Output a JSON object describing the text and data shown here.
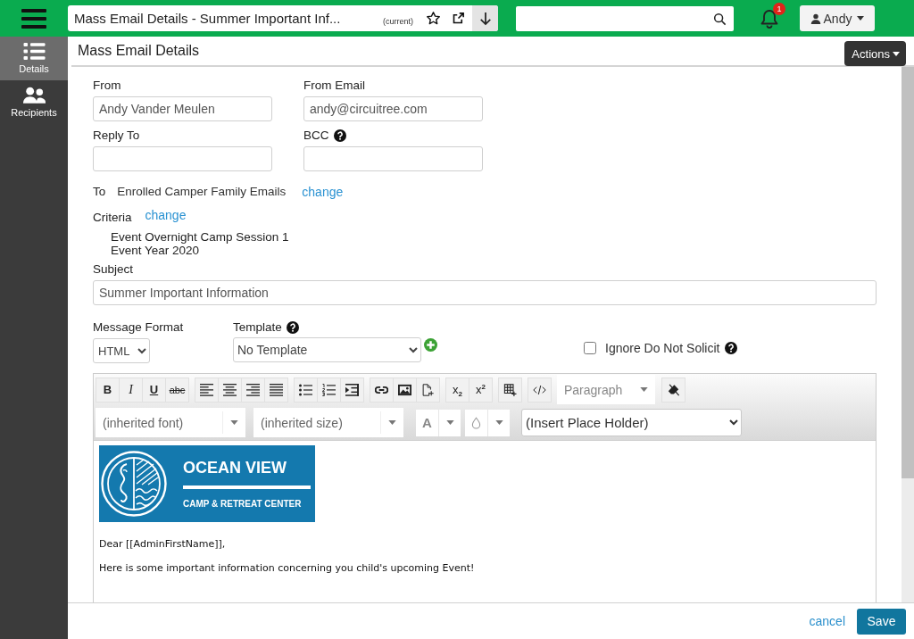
{
  "top_bar": {
    "page_title": "Mass Email Details - Summer Important Inf...",
    "page_tag": "(current)",
    "notification_count": "1",
    "user_name": "Andy"
  },
  "sidebar": {
    "items": [
      {
        "label": "Details",
        "selected": true
      },
      {
        "label": "Recipients",
        "selected": false
      }
    ]
  },
  "header": {
    "title": "Mass Email Details",
    "actions": "Actions"
  },
  "form": {
    "from": {
      "label": "From",
      "value": "Andy Vander Meulen"
    },
    "from_email": {
      "label": "From Email",
      "value": "andy@circuitree.com"
    },
    "reply_to": {
      "label": "Reply To"
    },
    "bcc": {
      "label": "BCC"
    },
    "to": {
      "label": "To",
      "value": "Enrolled Camper Family Emails",
      "link": "change"
    },
    "criteria": {
      "label": "Criteria",
      "link": "change",
      "lines": [
        "Event Overnight Camp Session 1",
        "Event Year 2020"
      ]
    },
    "subject": {
      "label": "Subject",
      "value": "Summer Important Information"
    },
    "message_format": {
      "label": "Message Format",
      "value": "HTML"
    },
    "template": {
      "label": "Template",
      "value": "No Template"
    },
    "ignore_do_not_solicit": {
      "label": "Ignore Do Not Solicit",
      "checked": false
    }
  },
  "editor": {
    "format_buttons": [
      {
        "label": "B",
        "kind": "bold"
      },
      {
        "label": "I",
        "kind": "italic"
      },
      {
        "label": "U",
        "kind": "underline"
      },
      {
        "label": "abc",
        "kind": "strike"
      }
    ],
    "script_buttons": [
      "x$_{2}$",
      "x$^{2}$"
    ],
    "block_format": "Paragraph",
    "font": "(inherited font)",
    "font_size": "(inherited size)",
    "text_color": "A",
    "placeholder_select": "(Insert Place Holder)",
    "content": {
      "logo_title": "OCEAN VIEW",
      "logo_subtitle": "CAMP & RETREAT CENTER",
      "paragraphs": [
        "Dear [[AdminFirstName]],",
        "Here is some important information concerning you child's upcoming Event!"
      ]
    }
  },
  "footer": {
    "cancel": "cancel",
    "save": "Save"
  }
}
